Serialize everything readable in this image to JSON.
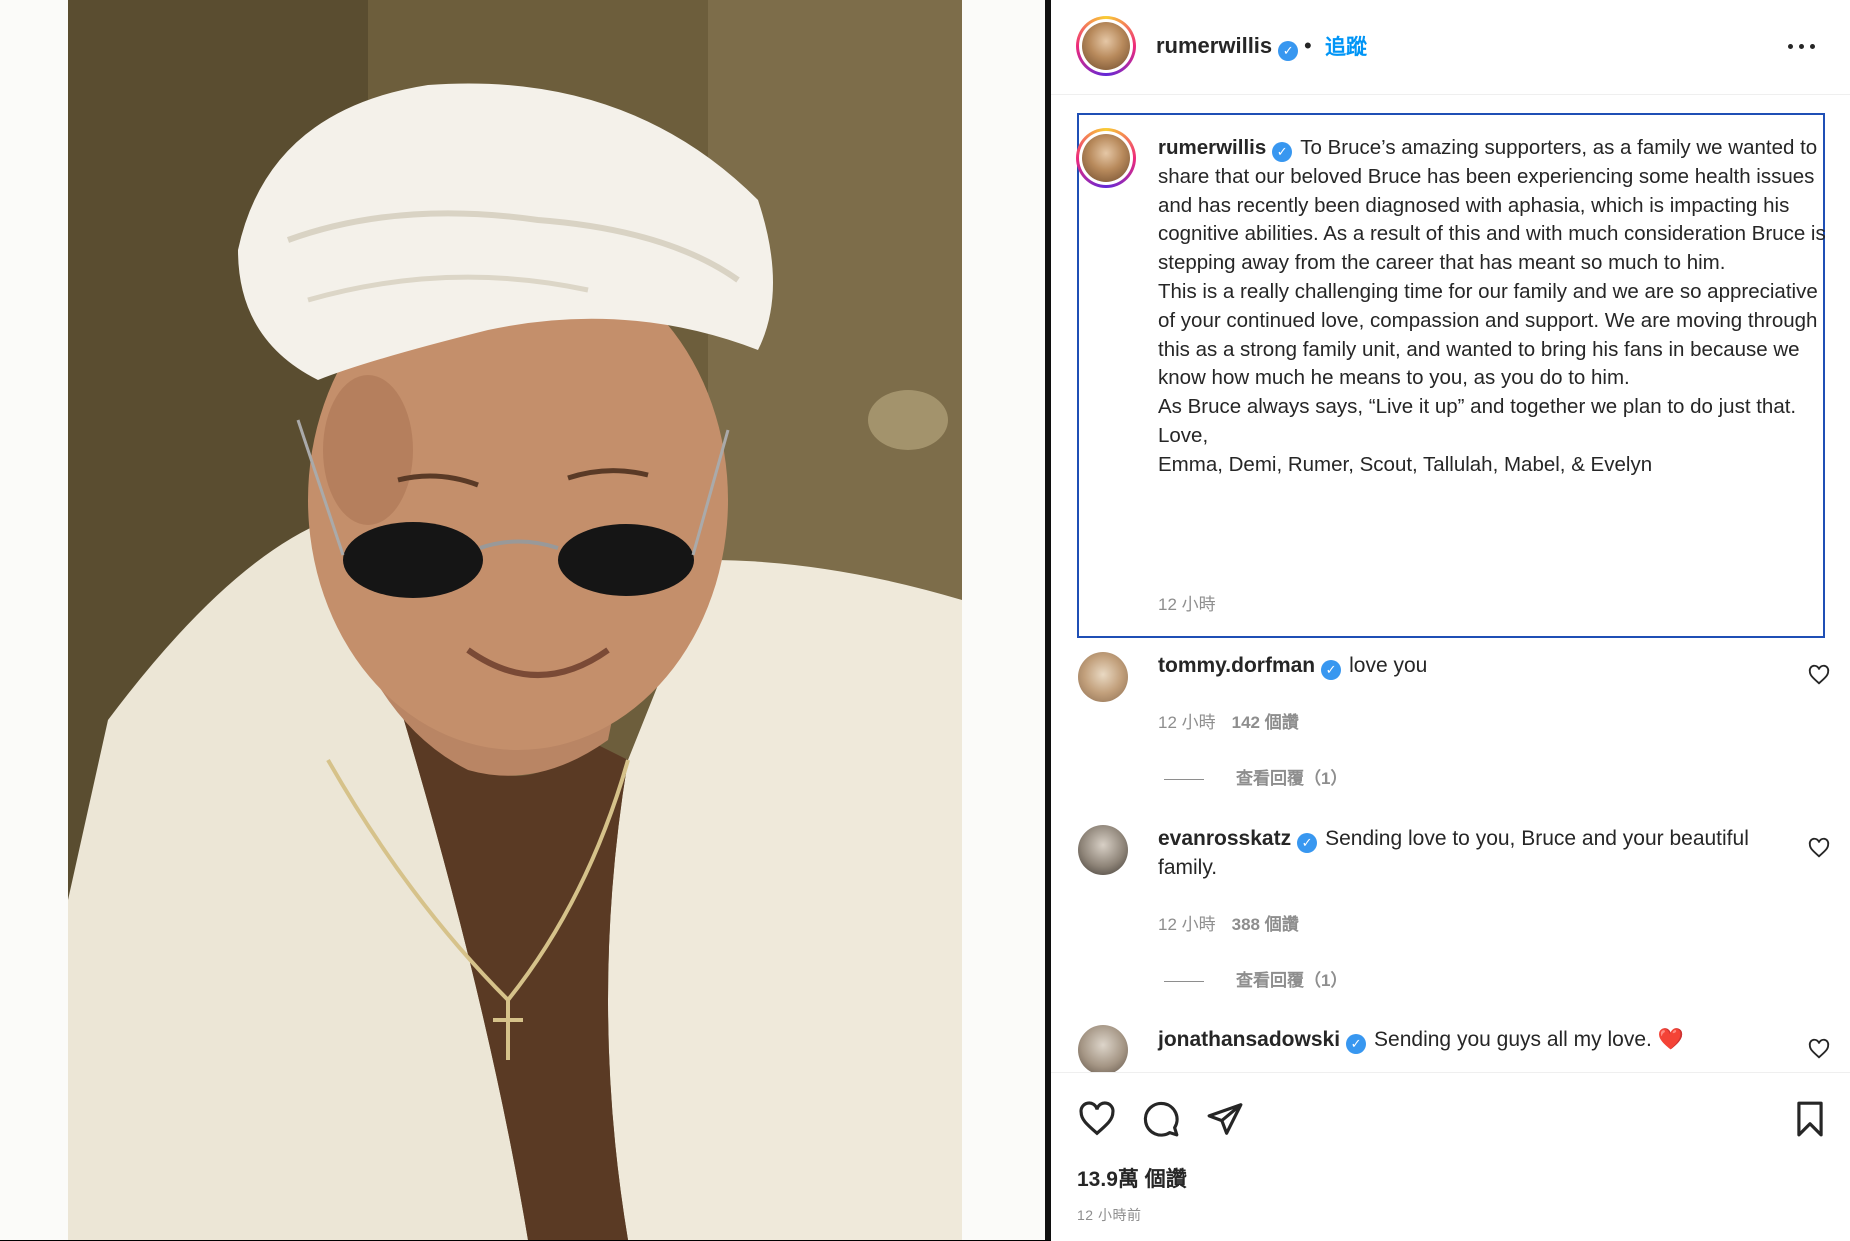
{
  "post": {
    "author": "rumerwillis",
    "follow_label": "追蹤",
    "separator": "•",
    "caption": {
      "username": "rumerwillis",
      "paragraphs": [
        "To Bruce’s amazing supporters, as a family we wanted to share that our beloved Bruce has been experiencing some health issues and has recently been diagnosed with aphasia, which is impacting his cognitive abilities. As a result of this and with much consideration Bruce is stepping away from the career that has meant so much to him.",
        "This is a really challenging time for our family and we are so appreciative of your continued love, compassion and support. We are moving through this as a strong family unit, and wanted to bring his fans in because we know how much he means to you, as you do to him.",
        "As Bruce always says, “Live it up” and together we plan to do just that.",
        "Love,",
        "Emma, Demi, Rumer, Scout, Tallulah, Mabel, & Evelyn"
      ],
      "time": "12 小時"
    },
    "comments": [
      {
        "username": "tommy.dorfman",
        "text": "love you",
        "time": "12 小時",
        "likes": "142 個讚",
        "replies": "查看回覆（1）"
      },
      {
        "username": "evanrosskatz",
        "text": "Sending love to you, Bruce and your beautiful family.",
        "time": "12 小時",
        "likes": "388 個讚",
        "replies": "查看回覆（1）"
      },
      {
        "username": "jonathansadowski",
        "text": "Sending you guys all my love.",
        "emoji": "❤️"
      }
    ],
    "likes_total": "13.9萬 個讚",
    "posted_ago": "12 小時前",
    "colors": {
      "accent": "#0095f6",
      "verified": "#3897f0",
      "focus_border": "#1f4fb5"
    }
  }
}
